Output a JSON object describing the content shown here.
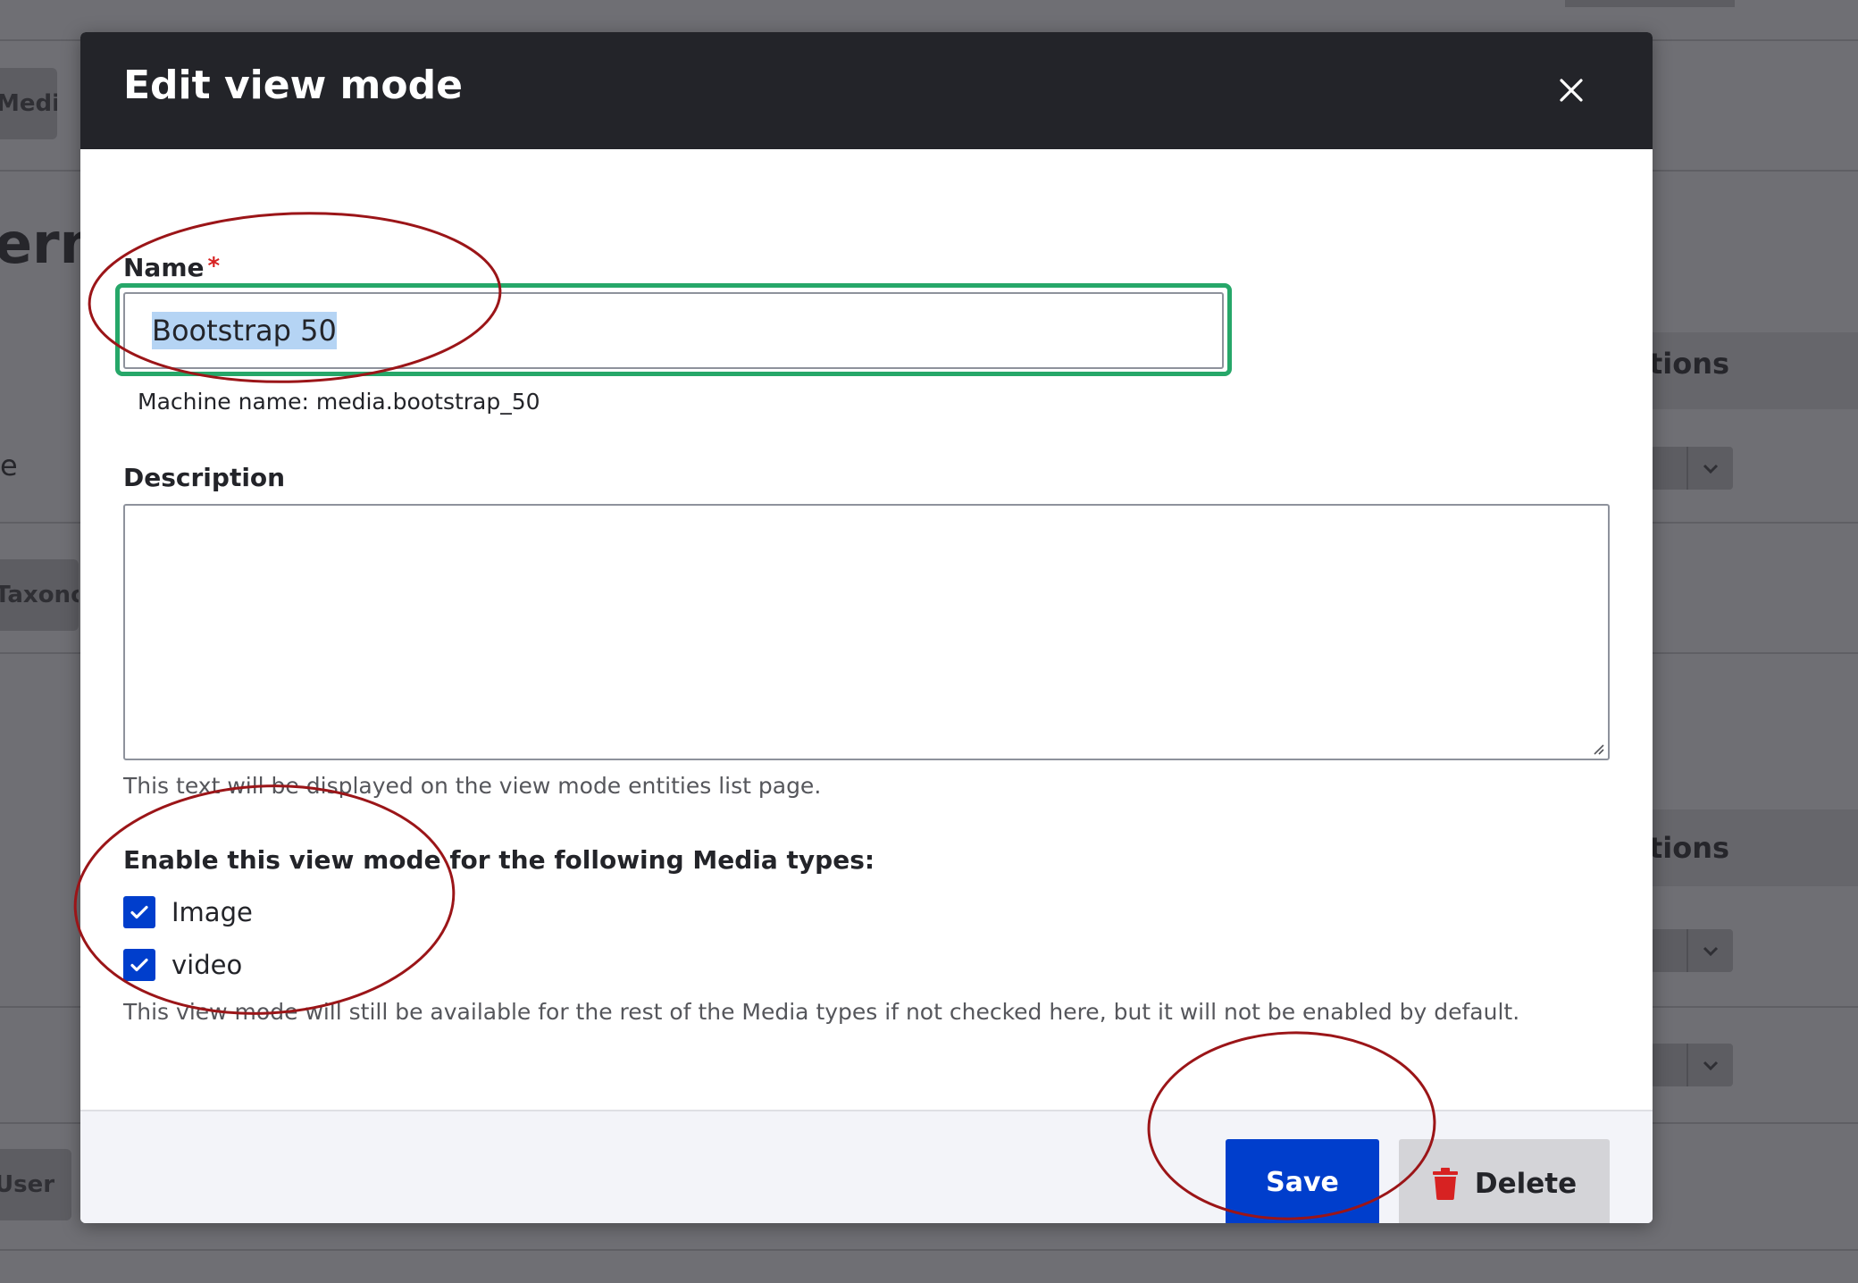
{
  "background": {
    "tags": [
      "Media",
      "Taxonomy",
      "User"
    ],
    "heading": "erm",
    "operations_labels": [
      "tions",
      "tions"
    ],
    "side_text": "e"
  },
  "dialog": {
    "title": "Edit view mode",
    "close_icon": "close-icon"
  },
  "form": {
    "name": {
      "label": "Name",
      "required_mark": "*",
      "value": "Bootstrap 50",
      "machine_name": "Machine name: media.bootstrap_50"
    },
    "description": {
      "label": "Description",
      "value": "",
      "help": "This text will be displayed on the view mode entities list page."
    },
    "media_types": {
      "label": "Enable this view mode for the following Media types:",
      "options": [
        {
          "label": "Image",
          "checked": true
        },
        {
          "label": "video",
          "checked": true
        }
      ],
      "help": "This view mode will still be available for the rest of the Media types if not checked here, but it will not be enabled by default."
    }
  },
  "footer": {
    "save_label": "Save",
    "delete_label": "Delete",
    "delete_icon": "trash-icon"
  },
  "colors": {
    "header_bg": "#232429",
    "primary": "#003ecc",
    "focus_ring": "#26a769",
    "required": "#d72222",
    "danger_icon": "#d72222",
    "annotation": "#9b1518",
    "selection": "#b5d4f4"
  }
}
